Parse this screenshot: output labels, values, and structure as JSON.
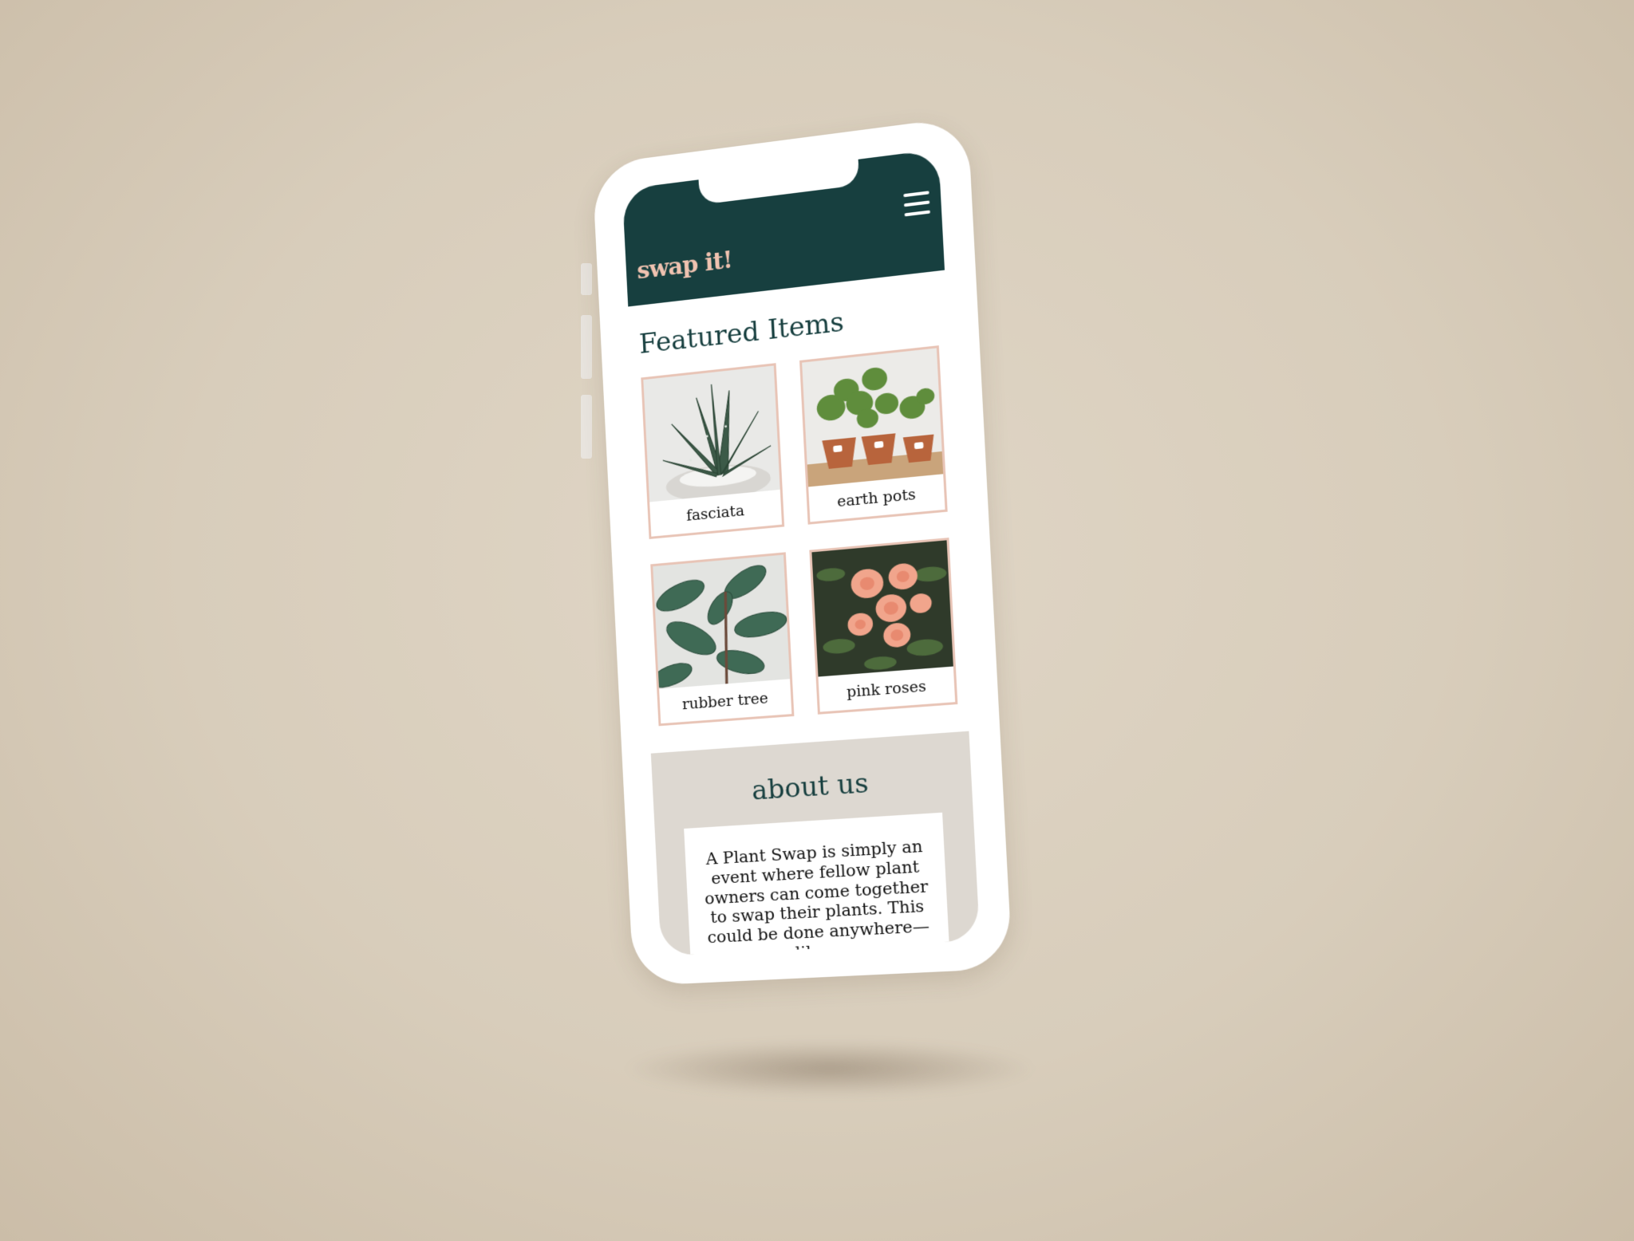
{
  "app": {
    "logo": "swap it!",
    "menu_icon": "hamburger-menu-icon"
  },
  "featured": {
    "title": "Featured Items",
    "items": [
      {
        "label": "fasciata",
        "image": "aloe-plant-photo"
      },
      {
        "label": "earth pots",
        "image": "potted-herbs-photo"
      },
      {
        "label": "rubber tree",
        "image": "rubber-tree-photo"
      },
      {
        "label": "pink roses",
        "image": "pink-roses-photo"
      }
    ]
  },
  "about": {
    "title": "about us",
    "text": "A Plant Swap is simply an event where fellow plant owners can come together to swap their plants. This could be done anywhere—like a"
  },
  "colors": {
    "header": "#173f3f",
    "logo": "#efc2b0",
    "card_border": "#e8c4b6",
    "about_bg": "#ddd8d1",
    "page_bg": "#d8cdbb"
  }
}
